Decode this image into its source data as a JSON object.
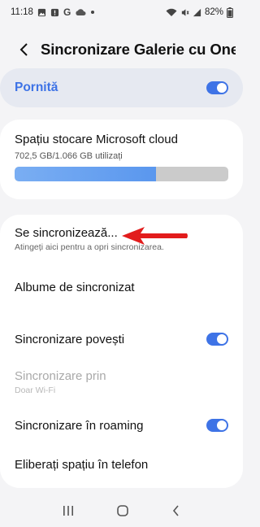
{
  "status_bar": {
    "time": "11:18",
    "battery": "82%",
    "notification_icons": [
      "image-icon",
      "alert-badge-icon",
      "google-icon",
      "cloud-icon",
      "dot-icon"
    ],
    "system_icons": [
      "wifi-icon",
      "mute-icon",
      "signal-icon",
      "battery-icon"
    ]
  },
  "header": {
    "title": "Sincronizare Galerie cu One..."
  },
  "master": {
    "label": "Pornită",
    "toggle_on": true
  },
  "storage": {
    "title": "Spațiu stocare Microsoft cloud",
    "usage": "702,5 GB/1.066 GB utilizați",
    "used_fraction": 0.66
  },
  "settings": {
    "sync_now": {
      "title": "Se sincronizează...",
      "subtitle": "Atingeți aici pentru a opri sincronizarea."
    },
    "albums": {
      "title": "Albume de sincronizat"
    },
    "stories": {
      "title": "Sincronizare povești",
      "toggle_on": true
    },
    "sync_via": {
      "title": "Sincronizare prin",
      "subtitle": "Doar Wi-Fi"
    },
    "roaming": {
      "title": "Sincronizare în roaming",
      "toggle_on": true
    },
    "free_space": {
      "title": "Eliberați spațiu în telefon"
    }
  },
  "colors": {
    "accent": "#3e73e6",
    "annotation_arrow": "#e21c1c",
    "background": "#f4f4f6"
  },
  "nav_bar": {
    "icons": [
      "recents-icon",
      "home-icon",
      "back-nav-icon"
    ]
  }
}
